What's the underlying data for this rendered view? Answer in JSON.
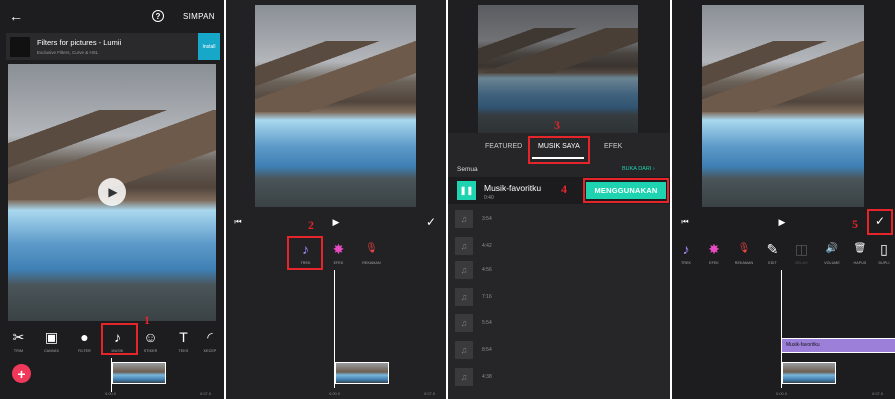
{
  "panel1": {
    "save_label": "SIMPAN",
    "ad": {
      "title": "Filters for pictures - Lumii",
      "subtitle": "Exclusive Filters, Curve & HSL",
      "button": "Install"
    },
    "tools": [
      {
        "icon": "scissors-icon",
        "glyph": "✂",
        "label": "TRIM"
      },
      {
        "icon": "canvas-icon",
        "glyph": "▣",
        "label": "CANVAS"
      },
      {
        "icon": "filter-icon",
        "glyph": "●",
        "label": "FILTER"
      },
      {
        "icon": "music-icon",
        "glyph": "♪",
        "label": "MUSIK"
      },
      {
        "icon": "sticker-icon",
        "glyph": "☺",
        "label": "STIKER"
      },
      {
        "icon": "text-icon",
        "glyph": "T",
        "label": "TEKS"
      },
      {
        "icon": "speed-icon",
        "glyph": "◜",
        "label": "KECEP"
      }
    ],
    "times": [
      "0:00.0",
      "0:07.0"
    ],
    "step": "1"
  },
  "panel2": {
    "step": "2",
    "tools": [
      {
        "icon": "music-add-icon",
        "glyph": "♪",
        "label": "TREK",
        "color": "#a78bfa"
      },
      {
        "icon": "effect-icon",
        "glyph": "✸",
        "label": "EFEK",
        "color": "#e64ac0"
      },
      {
        "icon": "mic-icon",
        "glyph": "🎙",
        "label": "REKAMAN",
        "color": "#ef4444"
      }
    ],
    "times": [
      "0:00.0",
      "0:07.0"
    ]
  },
  "panel3": {
    "tabs": [
      "FEATURED",
      "MUSIK SAYA",
      "EFEK"
    ],
    "step3": "3",
    "step4": "4",
    "all_label": "Semua",
    "open_from": "BUKA DARI  ›",
    "selected_track": {
      "name": "Musik-favoritku",
      "duration": "0:40"
    },
    "use_button": "MENGGUNAKAN",
    "tracks": [
      "3:54",
      "4:42",
      "4:56",
      "7:16",
      "5:54",
      "8:54",
      "4:38"
    ]
  },
  "panel4": {
    "step": "5",
    "tools": [
      {
        "icon": "music-add-icon",
        "glyph": "♪",
        "label": "TREK",
        "color": "#a78bfa"
      },
      {
        "icon": "effect-icon",
        "glyph": "✸",
        "label": "EFEK",
        "color": "#e64ac0"
      },
      {
        "icon": "mic-icon",
        "glyph": "🎙",
        "label": "REKAMAN",
        "color": "#ef4444"
      },
      {
        "icon": "edit-icon",
        "glyph": "✎",
        "label": "EDIT",
        "color": "#ffffff"
      },
      {
        "icon": "split-icon",
        "glyph": "◫",
        "label": "BELAH",
        "color": "#555555"
      },
      {
        "icon": "volume-icon",
        "glyph": "🔊",
        "label": "VOLUME",
        "color": "#ffffff"
      },
      {
        "icon": "delete-icon",
        "glyph": "🗑",
        "label": "HAPUS",
        "color": "#ffffff"
      },
      {
        "icon": "duplicate-icon",
        "glyph": "▯",
        "label": "DUPLI",
        "color": "#ffffff"
      }
    ],
    "audio_clip": "Musik-favoritku",
    "times": [
      "0:00.0",
      "0:07.0"
    ]
  }
}
